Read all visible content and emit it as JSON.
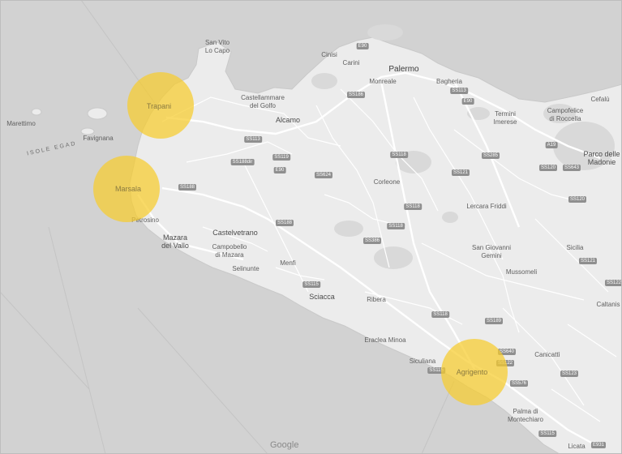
{
  "map": {
    "colors": {
      "land": "#ededed",
      "sea": "#cfcfcf",
      "road": "#ffffff",
      "relief": "#d6d6d6",
      "marker": "#f6cc2c"
    },
    "places": [
      {
        "id": "san-vito",
        "label": "San Vito\nLo Capo",
        "kind": "town"
      },
      {
        "id": "palermo",
        "label": "Palermo",
        "kind": "major"
      },
      {
        "id": "cinisi",
        "label": "Cinisi",
        "kind": "town"
      },
      {
        "id": "carini",
        "label": "Carini",
        "kind": "town"
      },
      {
        "id": "monreale",
        "label": "Monreale",
        "kind": "town"
      },
      {
        "id": "bagheria",
        "label": "Bagheria",
        "kind": "town"
      },
      {
        "id": "termini",
        "label": "Termini\nImerese",
        "kind": "town"
      },
      {
        "id": "campofelice",
        "label": "Campofelice\ndi Roccella",
        "kind": "town"
      },
      {
        "id": "cefalu",
        "label": "Cefalù",
        "kind": "town"
      },
      {
        "id": "castellammare",
        "label": "Castellammare\ndel Golfo",
        "kind": "town"
      },
      {
        "id": "alcamo",
        "label": "Alcamo",
        "kind": "city"
      },
      {
        "id": "marettimo",
        "label": "Marettimo",
        "kind": "town"
      },
      {
        "id": "favignana",
        "label": "Favignana",
        "kind": "town"
      },
      {
        "id": "isole-egad",
        "label": "ISOLE EGAD",
        "kind": "sea"
      },
      {
        "id": "parco-madonie",
        "label": "Parco delle\nMadonie",
        "kind": "city"
      },
      {
        "id": "corleone",
        "label": "Corleone",
        "kind": "town"
      },
      {
        "id": "lercara",
        "label": "Lercara Friddi",
        "kind": "town"
      },
      {
        "id": "castelvetrano",
        "label": "Castelvetrano",
        "kind": "city"
      },
      {
        "id": "petrosino",
        "label": "Petrosino",
        "kind": "town"
      },
      {
        "id": "mazara",
        "label": "Mazara\ndel Vallo",
        "kind": "city"
      },
      {
        "id": "campobello",
        "label": "Campobello\ndi Mazara",
        "kind": "town"
      },
      {
        "id": "selinunte",
        "label": "Selinunte",
        "kind": "town"
      },
      {
        "id": "menfi",
        "label": "Menfi",
        "kind": "town"
      },
      {
        "id": "san-giovanni",
        "label": "San Giovanni\nGemini",
        "kind": "town"
      },
      {
        "id": "sicilia",
        "label": "Sicilia",
        "kind": "town"
      },
      {
        "id": "mussomeli",
        "label": "Mussomeli",
        "kind": "town"
      },
      {
        "id": "sciacca",
        "label": "Sciacca",
        "kind": "city"
      },
      {
        "id": "ribera",
        "label": "Ribera",
        "kind": "town"
      },
      {
        "id": "caltanissetta",
        "label": "Caltanis",
        "kind": "town"
      },
      {
        "id": "eraclea",
        "label": "Eraclea Minoa",
        "kind": "town"
      },
      {
        "id": "siculiana",
        "label": "Siculiana",
        "kind": "town"
      },
      {
        "id": "canicatti",
        "label": "Canicattì",
        "kind": "town"
      },
      {
        "id": "palma",
        "label": "Palma di\nMontechiaro",
        "kind": "town"
      },
      {
        "id": "licata",
        "label": "Licata",
        "kind": "town"
      },
      {
        "id": "trapani",
        "label": "Trapani",
        "kind": "highlight"
      },
      {
        "id": "marsala",
        "label": "Marsala",
        "kind": "highlight"
      },
      {
        "id": "agrigento",
        "label": "Agrigento",
        "kind": "highlight"
      }
    ],
    "shields": [
      {
        "id": "e90-top",
        "label": "E90"
      },
      {
        "id": "ss186",
        "label": "SS186"
      },
      {
        "id": "ss113-a",
        "label": "SS113"
      },
      {
        "id": "e90-b",
        "label": "E90"
      },
      {
        "id": "a19",
        "label": "A19"
      },
      {
        "id": "ss113-b",
        "label": "SS113"
      },
      {
        "id": "ss119",
        "label": "SS119"
      },
      {
        "id": "ss188dir",
        "label": "SS188dir"
      },
      {
        "id": "e90-c",
        "label": "E90"
      },
      {
        "id": "ss624",
        "label": "SS624"
      },
      {
        "id": "ss118-a",
        "label": "SS118"
      },
      {
        "id": "ss285",
        "label": "SS285"
      },
      {
        "id": "ss121-a",
        "label": "SS121"
      },
      {
        "id": "ss120-a",
        "label": "SS120"
      },
      {
        "id": "ss643",
        "label": "SS643"
      },
      {
        "id": "ss120-b",
        "label": "SS120"
      },
      {
        "id": "ss188-a",
        "label": "SS188"
      },
      {
        "id": "ss118-b",
        "label": "SS118"
      },
      {
        "id": "ss188-b",
        "label": "SS188"
      },
      {
        "id": "ss118-c",
        "label": "SS118"
      },
      {
        "id": "ss386",
        "label": "SS386"
      },
      {
        "id": "ss121-b",
        "label": "SS121"
      },
      {
        "id": "ss122-a",
        "label": "SS122"
      },
      {
        "id": "ss115-a",
        "label": "SS115"
      },
      {
        "id": "ss118-d",
        "label": "SS118"
      },
      {
        "id": "ss189",
        "label": "SS189"
      },
      {
        "id": "ss640",
        "label": "SS640"
      },
      {
        "id": "ss122-b",
        "label": "SS122"
      },
      {
        "id": "ss115-b",
        "label": "SS115"
      },
      {
        "id": "ss576",
        "label": "SS576"
      },
      {
        "id": "ss123",
        "label": "SS123"
      },
      {
        "id": "ss115-c",
        "label": "SS115"
      },
      {
        "id": "e931",
        "label": "E931"
      }
    ],
    "markers": [
      {
        "id": "trapani-marker",
        "place": "Trapani"
      },
      {
        "id": "marsala-marker",
        "place": "Marsala"
      },
      {
        "id": "agrigento-marker",
        "place": "Agrigento"
      }
    ],
    "attribution": "Google"
  }
}
